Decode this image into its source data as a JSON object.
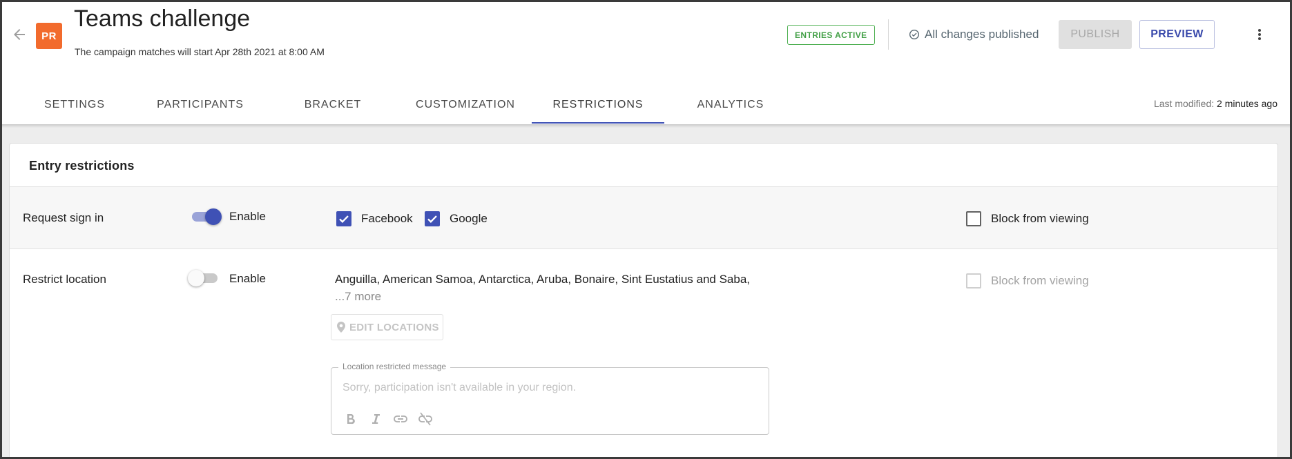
{
  "header": {
    "logo_text": "PR",
    "logo_color": "#f26b2d",
    "title": "Teams challenge",
    "subtitle": "The campaign matches will start Apr  28th 2021 at 8:00 AM",
    "status_badge": "ENTRIES ACTIVE",
    "published_text": "All changes published",
    "publish_label": "PUBLISH",
    "preview_label": "PREVIEW",
    "icons": [
      "back-arrow-icon",
      "check-circle-icon",
      "more-vert-icon"
    ]
  },
  "tabs": [
    {
      "label": "SETTINGS",
      "active": false
    },
    {
      "label": "PARTICIPANTS",
      "active": false
    },
    {
      "label": "BRACKET",
      "active": false
    },
    {
      "label": "CUSTOMIZATION",
      "active": false
    },
    {
      "label": "RESTRICTIONS",
      "active": true
    },
    {
      "label": "ANALYTICS",
      "active": false
    }
  ],
  "last_modified": {
    "label": "Last modified:",
    "value": "2 minutes ago"
  },
  "card": {
    "title": "Entry restrictions",
    "sign_in": {
      "label": "Request sign in",
      "toggle_label": "Enable",
      "enabled": true,
      "providers": [
        {
          "label": "Facebook",
          "checked": true
        },
        {
          "label": "Google",
          "checked": true
        }
      ],
      "block_label": "Block from viewing",
      "block_checked": false
    },
    "location": {
      "label": "Restrict location",
      "toggle_label": "Enable",
      "enabled": false,
      "locations_text": "Anguilla, American Samoa, Antarctica, Aruba, Bonaire, Sint Eustatius and Saba,",
      "more_text": "...7 more",
      "edit_label": "EDIT LOCATIONS",
      "message_legend": "Location restricted message",
      "message_placeholder": "Sorry, participation isn't available in your region.",
      "block_label": "Block from viewing",
      "block_checked": false,
      "block_disabled": true
    }
  },
  "colors": {
    "accent": "#3f51b5",
    "success": "#43a047",
    "brand": "#f26b2d"
  }
}
